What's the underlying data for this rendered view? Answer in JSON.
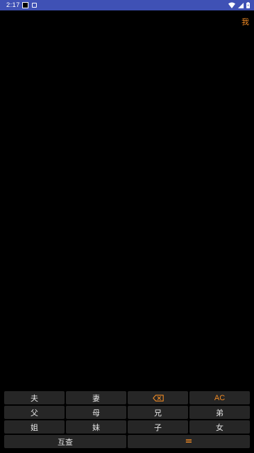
{
  "status_bar": {
    "time": "2:17",
    "icons": [
      "notification-square-icon",
      "notification-a-icon",
      "wifi-icon",
      "signal-icon",
      "battery-icon"
    ],
    "background": "#3f51b5"
  },
  "display": {
    "value": "我",
    "color": "#f08a24"
  },
  "keypad": {
    "row1": {
      "k1": "夫",
      "k2": "妻",
      "k3_icon": "backspace-icon",
      "k4": "AC"
    },
    "row2": {
      "k1": "父",
      "k2": "母",
      "k3": "兄",
      "k4": "弟"
    },
    "row3": {
      "k1": "姐",
      "k2": "妹",
      "k3": "子",
      "k4": "女"
    },
    "row4": {
      "k1": "互查",
      "k2": "="
    },
    "accent": "#f08a24",
    "key_background": "#262626"
  }
}
